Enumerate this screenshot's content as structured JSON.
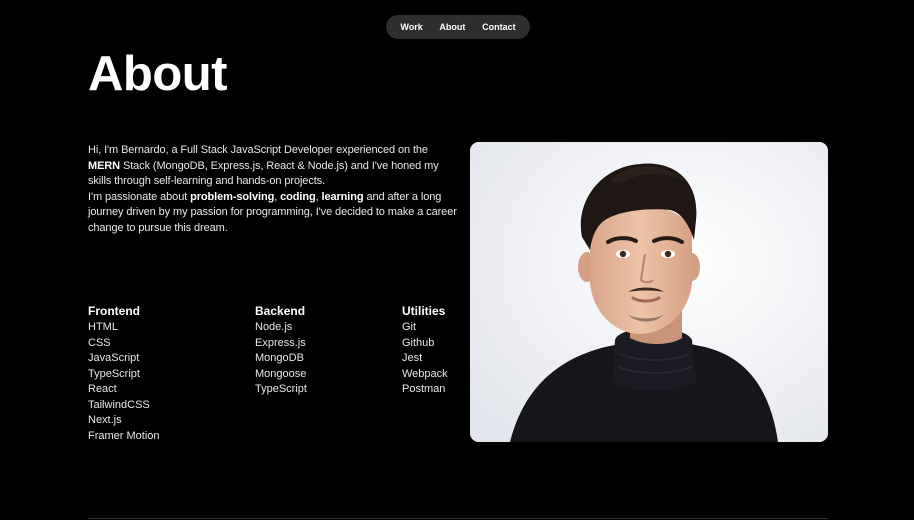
{
  "nav": {
    "items": [
      "Work",
      "About",
      "Contact"
    ]
  },
  "page": {
    "title": "About"
  },
  "bio": {
    "p1_a": "Hi, I'm Bernardo, a Full Stack JavaScript Developer experienced on the ",
    "p1_b": "MERN",
    "p1_c": " Stack (MongoDB, Express.js, React & Node.js) and I've honed my skills through self-learning and hands-on projects.",
    "p2_a": "I'm passionate about ",
    "p2_b": "problem-solving",
    "p2_c": ", ",
    "p2_d": "coding",
    "p2_e": ", ",
    "p2_f": "learning",
    "p2_g": " and after a long journey driven by my passion for programming, I've decided to make a career change to pursue this dream."
  },
  "skills": [
    {
      "heading": "Frontend",
      "items": [
        "HTML",
        "CSS",
        "JavaScript",
        "TypeScript",
        "React",
        "TailwindCSS",
        "Next.js",
        "Framer Motion"
      ]
    },
    {
      "heading": "Backend",
      "items": [
        "Node.js",
        "Express.js",
        "MongoDB",
        "Mongoose",
        "TypeScript"
      ]
    },
    {
      "heading": "Utilities",
      "items": [
        "Git",
        "Github",
        "Jest",
        "Webpack",
        "Postman"
      ]
    }
  ],
  "photo": {
    "subject": "portrait-photo"
  },
  "colors": {
    "background": "#000000",
    "nav_pill": "#2e2e2e",
    "text": "#ffffff"
  }
}
